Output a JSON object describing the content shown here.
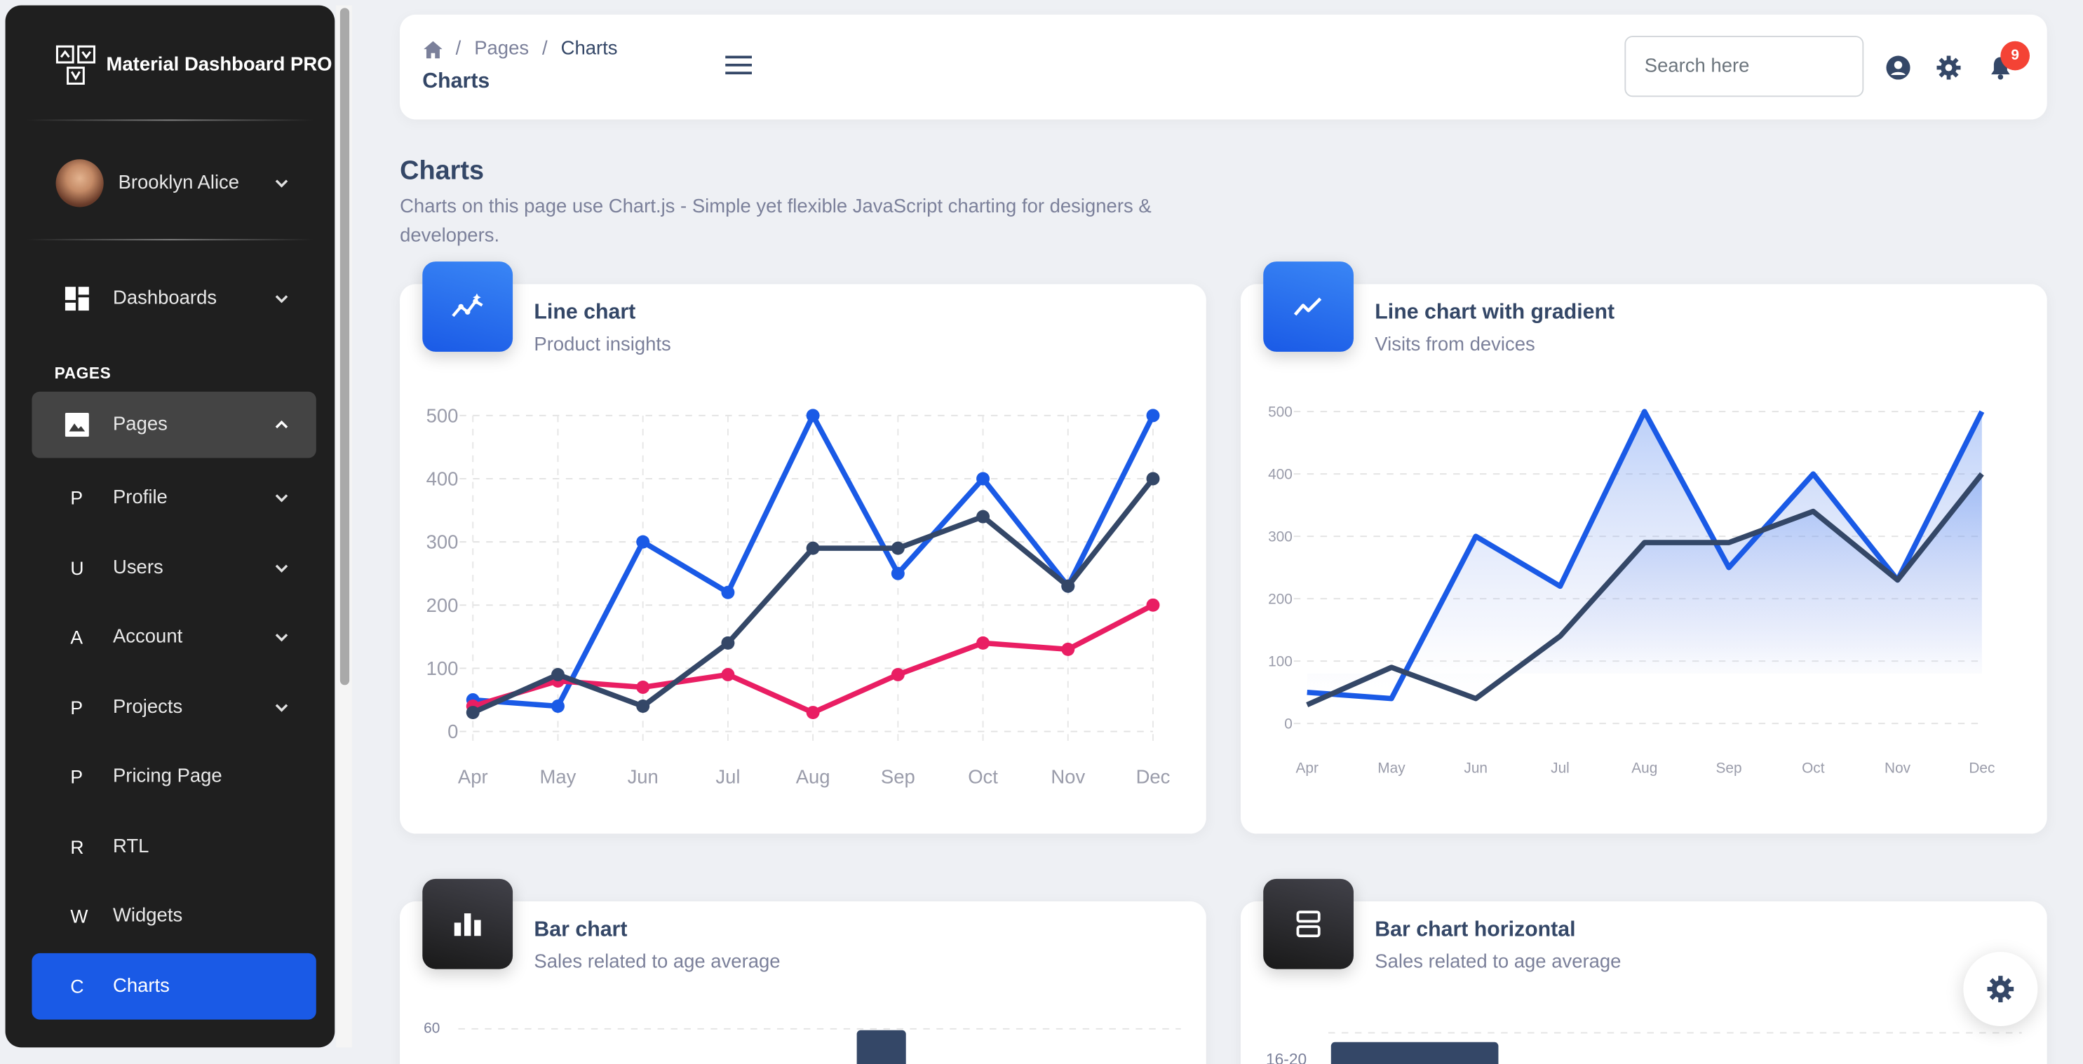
{
  "brand": {
    "name": "Material Dashboard PRO"
  },
  "user": {
    "name": "Brooklyn Alice"
  },
  "sidebar": {
    "section_title": "PAGES",
    "items": [
      {
        "label": "Dashboards",
        "icon": "dashboard-icon"
      },
      {
        "label": "Pages",
        "icon": "image-icon"
      },
      {
        "letter": "P",
        "label": "Profile"
      },
      {
        "letter": "U",
        "label": "Users"
      },
      {
        "letter": "A",
        "label": "Account"
      },
      {
        "letter": "P",
        "label": "Projects"
      },
      {
        "letter": "P",
        "label": "Pricing Page"
      },
      {
        "letter": "R",
        "label": "RTL"
      },
      {
        "letter": "W",
        "label": "Widgets"
      },
      {
        "letter": "C",
        "label": "Charts"
      }
    ],
    "active_color": "#1A5AE6"
  },
  "navbar": {
    "breadcrumb": [
      "Pages",
      "Charts"
    ],
    "title": "Charts",
    "search_placeholder": "Search here",
    "notification_count": "9"
  },
  "page": {
    "title": "Charts",
    "description": "Charts on this page use Chart.js - Simple yet flexible JavaScript charting for designers & developers."
  },
  "cards": {
    "line": {
      "title": "Line chart",
      "subtitle": "Product insights",
      "icon": "sparkline-icon"
    },
    "gradient": {
      "title": "Line chart with gradient",
      "subtitle": "Visits from devices",
      "icon": "trending-up-icon"
    },
    "bar": {
      "title": "Bar chart",
      "subtitle": "Sales related to age average",
      "icon": "bar-chart-icon"
    },
    "barh": {
      "title": "Bar chart horizontal",
      "subtitle": "Sales related to age average",
      "icon": "horizontal-bars-icon"
    }
  },
  "chart_data": [
    {
      "type": "line",
      "categories": [
        "Apr",
        "May",
        "Jun",
        "Jul",
        "Aug",
        "Sep",
        "Oct",
        "Nov",
        "Dec"
      ],
      "ylim": [
        0,
        500
      ],
      "yticks": [
        "0",
        "100",
        "200",
        "300",
        "400",
        "500"
      ],
      "grid": true,
      "series": [
        {
          "color": "#1A5AE6",
          "values": [
            50,
            40,
            300,
            220,
            500,
            250,
            400,
            230,
            500
          ]
        },
        {
          "color": "#E91E63",
          "values": [
            40,
            80,
            70,
            90,
            30,
            90,
            140,
            130,
            200
          ]
        },
        {
          "color": "#344767",
          "values": [
            30,
            90,
            40,
            140,
            290,
            290,
            340,
            230,
            400
          ]
        }
      ]
    },
    {
      "type": "area",
      "categories": [
        "Apr",
        "May",
        "Jun",
        "Jul",
        "Aug",
        "Sep",
        "Oct",
        "Nov",
        "Dec"
      ],
      "ylim": [
        0,
        500
      ],
      "yticks": [
        "0",
        "100",
        "200",
        "300",
        "400",
        "500"
      ],
      "grid": true,
      "series": [
        {
          "color": "#1A5AE6",
          "values": [
            50,
            40,
            300,
            220,
            500,
            250,
            400,
            230,
            500
          ]
        },
        {
          "color": "#344767",
          "values": [
            30,
            90,
            40,
            140,
            290,
            290,
            340,
            230,
            400
          ]
        }
      ]
    },
    {
      "type": "bar",
      "visible_tick": "60",
      "visible_bar_color": "#344767"
    },
    {
      "type": "bar",
      "orientation": "horizontal",
      "visible_category": "16-20",
      "visible_bar_color": "#344767"
    }
  ]
}
